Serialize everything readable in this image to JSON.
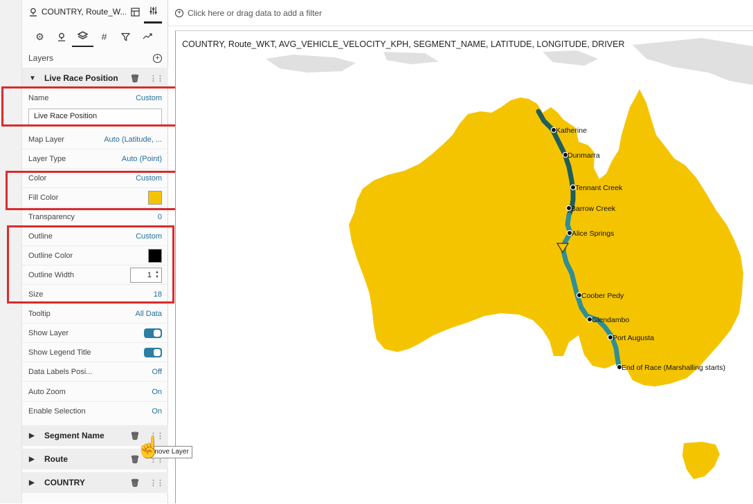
{
  "panel": {
    "dataset_tab": "COUNTRY, Route_W...",
    "layers_label": "Layers",
    "active_layer": {
      "name": "Live Race Position",
      "properties": {
        "name_label": "Name",
        "name_value": "Custom",
        "name_input": "Live Race Position",
        "map_layer_label": "Map Layer",
        "map_layer_value": "Auto (Latitude, ...",
        "layer_type_label": "Layer Type",
        "layer_type_value": "Auto (Point)",
        "color_label": "Color",
        "color_value": "Custom",
        "fill_color_label": "Fill Color",
        "fill_color": "#f5c400",
        "transparency_label": "Transparency",
        "transparency_value": "0",
        "outline_label": "Outline",
        "outline_value": "Custom",
        "outline_color_label": "Outline Color",
        "outline_color": "#000000",
        "outline_width_label": "Outline Width",
        "outline_width_value": "1",
        "size_label": "Size",
        "size_value": "18",
        "tooltip_label": "Tooltip",
        "tooltip_value": "All Data",
        "show_layer_label": "Show Layer",
        "show_legend_title_label": "Show Legend Title",
        "data_labels_label": "Data Labels Posi...",
        "data_labels_value": "Off",
        "auto_zoom_label": "Auto Zoom",
        "auto_zoom_value": "On",
        "enable_selection_label": "Enable Selection",
        "enable_selection_value": "On"
      }
    },
    "other_layers": [
      "Segment Name",
      "Route",
      "COUNTRY"
    ],
    "tooltip_text": "emove Layer"
  },
  "filter_bar": {
    "placeholder": "Click here or drag data to add a filter"
  },
  "viz": {
    "title": "COUNTRY, Route_WKT, AVG_VEHICLE_VELOCITY_KPH, SEGMENT_NAME, LATITUDE, LONGITUDE, DRIVER",
    "route_points": [
      "Katherine",
      "Dunmarra",
      "Tennant Creek",
      "Barrow Creek",
      "Alice Springs",
      "Coober Pedy",
      "Glendambo",
      "Port Augusta",
      "End of Race (Marshalling starts)"
    ],
    "colors": {
      "land": "#f5c400",
      "route_dark": "#1f5e5a",
      "route_teal": "#2f8f94",
      "other_land": "#e0e0e0"
    }
  }
}
